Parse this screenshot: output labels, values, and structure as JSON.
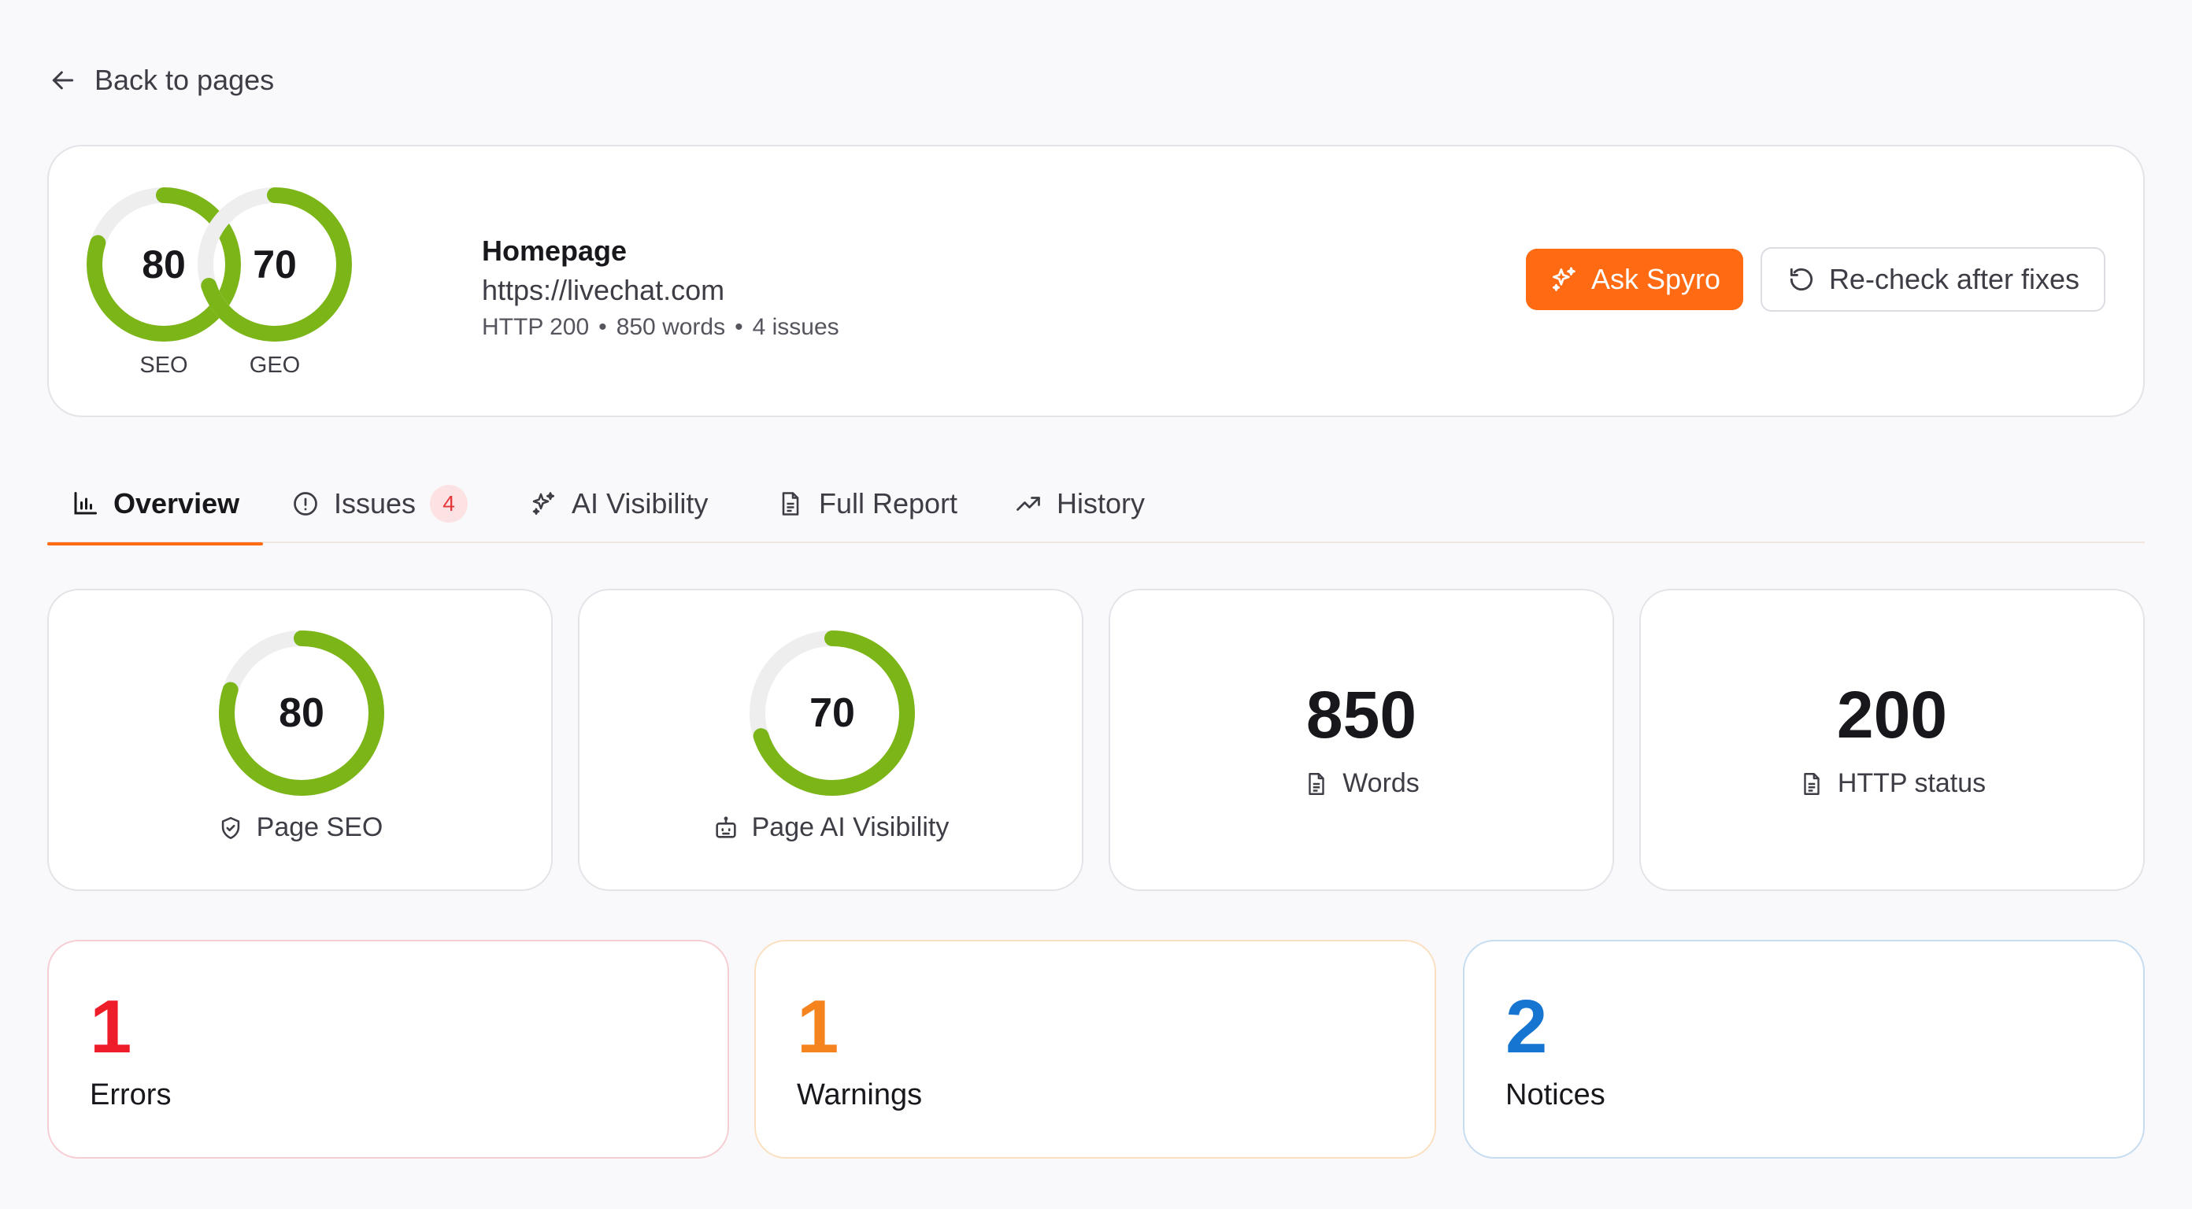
{
  "back": {
    "label": "Back to pages"
  },
  "header": {
    "gauges": [
      {
        "label": "SEO",
        "value": 80
      },
      {
        "label": "GEO",
        "value": 70
      }
    ],
    "page_name": "Homepage",
    "url": "https://livechat.com",
    "meta": {
      "http": "HTTP 200",
      "words": "850 words",
      "issues": "4 issues",
      "separator": "•"
    },
    "ask_button": "Ask Spyro",
    "recheck_button": "Re-check after fixes"
  },
  "tabs": [
    {
      "label": "Overview",
      "icon": "bar-chart-icon",
      "active": true
    },
    {
      "label": "Issues",
      "icon": "info-circle-icon",
      "badge": "4"
    },
    {
      "label": "AI Visibility",
      "icon": "sparkles-icon"
    },
    {
      "label": "Full Report",
      "icon": "document-icon"
    },
    {
      "label": "History",
      "icon": "trending-up-icon"
    }
  ],
  "stats": {
    "page_seo": {
      "value": 80,
      "label": "Page SEO",
      "icon": "shield-check-icon"
    },
    "page_ai": {
      "value": 70,
      "label": "Page AI Visibility",
      "icon": "robot-icon"
    },
    "words": {
      "value": "850",
      "label": "Words",
      "icon": "document-icon"
    },
    "http": {
      "value": "200",
      "label": "HTTP status",
      "icon": "document-icon"
    }
  },
  "issues": {
    "errors": {
      "count": "1",
      "label": "Errors"
    },
    "warnings": {
      "count": "1",
      "label": "Warnings"
    },
    "notices": {
      "count": "2",
      "label": "Notices"
    }
  },
  "colors": {
    "accent": "#ff6a13",
    "gauge": "#7cb518",
    "error": "#ee1d2a",
    "warning": "#f5841f",
    "notice": "#1675d1"
  }
}
